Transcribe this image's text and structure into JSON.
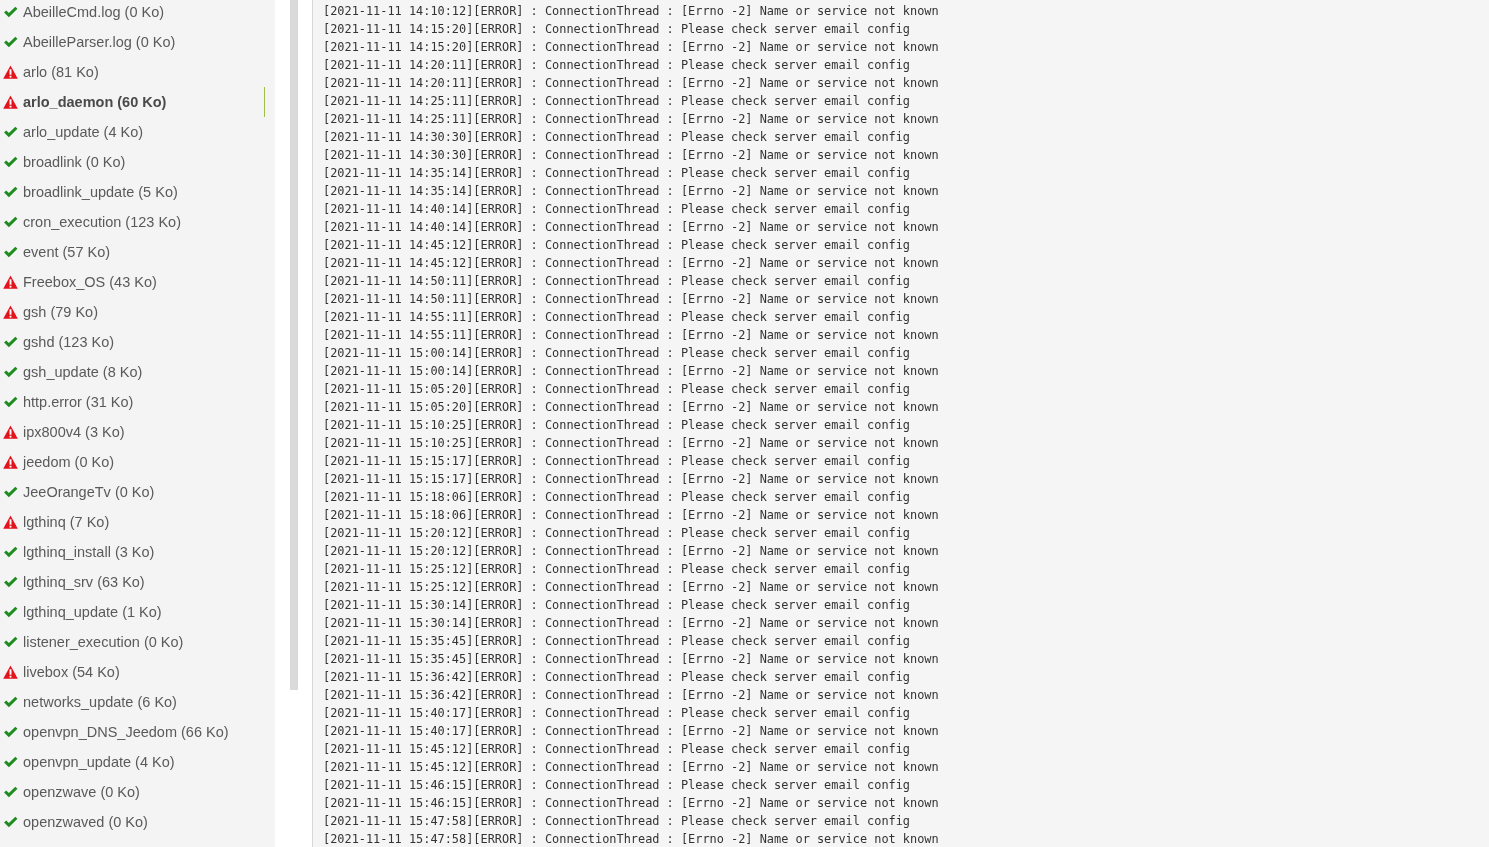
{
  "log_files": [
    {
      "name": "AbeilleCmd.log (0 Ko)",
      "kind": "ok",
      "selected": false
    },
    {
      "name": "AbeilleParser.log (0 Ko)",
      "kind": "ok",
      "selected": false
    },
    {
      "name": "arlo (81 Ko)",
      "kind": "warning",
      "selected": false
    },
    {
      "name": "arlo_daemon (60 Ko)",
      "kind": "warning",
      "selected": true
    },
    {
      "name": "arlo_update (4 Ko)",
      "kind": "ok",
      "selected": false
    },
    {
      "name": "broadlink (0 Ko)",
      "kind": "ok",
      "selected": false
    },
    {
      "name": "broadlink_update (5 Ko)",
      "kind": "ok",
      "selected": false
    },
    {
      "name": "cron_execution (123 Ko)",
      "kind": "ok",
      "selected": false
    },
    {
      "name": "event (57 Ko)",
      "kind": "ok",
      "selected": false
    },
    {
      "name": "Freebox_OS (43 Ko)",
      "kind": "warning",
      "selected": false
    },
    {
      "name": "gsh (79 Ko)",
      "kind": "warning",
      "selected": false
    },
    {
      "name": "gshd (123 Ko)",
      "kind": "ok",
      "selected": false
    },
    {
      "name": "gsh_update (8 Ko)",
      "kind": "ok",
      "selected": false
    },
    {
      "name": "http.error (31 Ko)",
      "kind": "ok",
      "selected": false
    },
    {
      "name": "ipx800v4 (3 Ko)",
      "kind": "warning",
      "selected": false
    },
    {
      "name": "jeedom (0 Ko)",
      "kind": "warning",
      "selected": false
    },
    {
      "name": "JeeOrangeTv (0 Ko)",
      "kind": "ok",
      "selected": false
    },
    {
      "name": "lgthinq (7 Ko)",
      "kind": "warning",
      "selected": false
    },
    {
      "name": "lgthinq_install (3 Ko)",
      "kind": "ok",
      "selected": false
    },
    {
      "name": "lgthinq_srv (63 Ko)",
      "kind": "ok",
      "selected": false
    },
    {
      "name": "lgthinq_update (1 Ko)",
      "kind": "ok",
      "selected": false
    },
    {
      "name": "listener_execution (0 Ko)",
      "kind": "ok",
      "selected": false
    },
    {
      "name": "livebox (54 Ko)",
      "kind": "warning",
      "selected": false
    },
    {
      "name": "networks_update (6 Ko)",
      "kind": "ok",
      "selected": false
    },
    {
      "name": "openvpn_DNS_Jeedom (66 Ko)",
      "kind": "ok",
      "selected": false
    },
    {
      "name": "openvpn_update (4 Ko)",
      "kind": "ok",
      "selected": false
    },
    {
      "name": "openzwave (0 Ko)",
      "kind": "ok",
      "selected": false
    },
    {
      "name": "openzwaved (0 Ko)",
      "kind": "ok",
      "selected": false
    }
  ],
  "log_lines": [
    "[2021-11-11 14:10:12][ERROR] : ConnectionThread : [Errno -2] Name or service not known",
    "[2021-11-11 14:15:20][ERROR] : ConnectionThread : Please check server email config",
    "[2021-11-11 14:15:20][ERROR] : ConnectionThread : [Errno -2] Name or service not known",
    "[2021-11-11 14:20:11][ERROR] : ConnectionThread : Please check server email config",
    "[2021-11-11 14:20:11][ERROR] : ConnectionThread : [Errno -2] Name or service not known",
    "[2021-11-11 14:25:11][ERROR] : ConnectionThread : Please check server email config",
    "[2021-11-11 14:25:11][ERROR] : ConnectionThread : [Errno -2] Name or service not known",
    "[2021-11-11 14:30:30][ERROR] : ConnectionThread : Please check server email config",
    "[2021-11-11 14:30:30][ERROR] : ConnectionThread : [Errno -2] Name or service not known",
    "[2021-11-11 14:35:14][ERROR] : ConnectionThread : Please check server email config",
    "[2021-11-11 14:35:14][ERROR] : ConnectionThread : [Errno -2] Name or service not known",
    "[2021-11-11 14:40:14][ERROR] : ConnectionThread : Please check server email config",
    "[2021-11-11 14:40:14][ERROR] : ConnectionThread : [Errno -2] Name or service not known",
    "[2021-11-11 14:45:12][ERROR] : ConnectionThread : Please check server email config",
    "[2021-11-11 14:45:12][ERROR] : ConnectionThread : [Errno -2] Name or service not known",
    "[2021-11-11 14:50:11][ERROR] : ConnectionThread : Please check server email config",
    "[2021-11-11 14:50:11][ERROR] : ConnectionThread : [Errno -2] Name or service not known",
    "[2021-11-11 14:55:11][ERROR] : ConnectionThread : Please check server email config",
    "[2021-11-11 14:55:11][ERROR] : ConnectionThread : [Errno -2] Name or service not known",
    "[2021-11-11 15:00:14][ERROR] : ConnectionThread : Please check server email config",
    "[2021-11-11 15:00:14][ERROR] : ConnectionThread : [Errno -2] Name or service not known",
    "[2021-11-11 15:05:20][ERROR] : ConnectionThread : Please check server email config",
    "[2021-11-11 15:05:20][ERROR] : ConnectionThread : [Errno -2] Name or service not known",
    "[2021-11-11 15:10:25][ERROR] : ConnectionThread : Please check server email config",
    "[2021-11-11 15:10:25][ERROR] : ConnectionThread : [Errno -2] Name or service not known",
    "[2021-11-11 15:15:17][ERROR] : ConnectionThread : Please check server email config",
    "[2021-11-11 15:15:17][ERROR] : ConnectionThread : [Errno -2] Name or service not known",
    "[2021-11-11 15:18:06][ERROR] : ConnectionThread : Please check server email config",
    "[2021-11-11 15:18:06][ERROR] : ConnectionThread : [Errno -2] Name or service not known",
    "[2021-11-11 15:20:12][ERROR] : ConnectionThread : Please check server email config",
    "[2021-11-11 15:20:12][ERROR] : ConnectionThread : [Errno -2] Name or service not known",
    "[2021-11-11 15:25:12][ERROR] : ConnectionThread : Please check server email config",
    "[2021-11-11 15:25:12][ERROR] : ConnectionThread : [Errno -2] Name or service not known",
    "[2021-11-11 15:30:14][ERROR] : ConnectionThread : Please check server email config",
    "[2021-11-11 15:30:14][ERROR] : ConnectionThread : [Errno -2] Name or service not known",
    "[2021-11-11 15:35:45][ERROR] : ConnectionThread : Please check server email config",
    "[2021-11-11 15:35:45][ERROR] : ConnectionThread : [Errno -2] Name or service not known",
    "[2021-11-11 15:36:42][ERROR] : ConnectionThread : Please check server email config",
    "[2021-11-11 15:36:42][ERROR] : ConnectionThread : [Errno -2] Name or service not known",
    "[2021-11-11 15:40:17][ERROR] : ConnectionThread : Please check server email config",
    "[2021-11-11 15:40:17][ERROR] : ConnectionThread : [Errno -2] Name or service not known",
    "[2021-11-11 15:45:12][ERROR] : ConnectionThread : Please check server email config",
    "[2021-11-11 15:45:12][ERROR] : ConnectionThread : [Errno -2] Name or service not known",
    "[2021-11-11 15:46:15][ERROR] : ConnectionThread : Please check server email config",
    "[2021-11-11 15:46:15][ERROR] : ConnectionThread : [Errno -2] Name or service not known",
    "[2021-11-11 15:47:58][ERROR] : ConnectionThread : Please check server email config",
    "[2021-11-11 15:47:58][ERROR] : ConnectionThread : [Errno -2] Name or service not known"
  ]
}
